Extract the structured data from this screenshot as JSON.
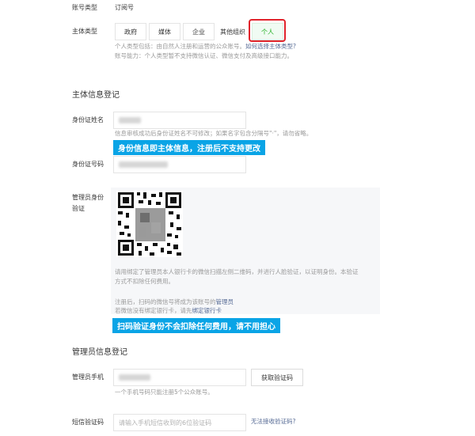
{
  "account_type": {
    "label": "账号类型",
    "value": "订阅号"
  },
  "entity_type": {
    "label": "主体类型",
    "options": [
      {
        "label": "政府"
      },
      {
        "label": "媒体"
      },
      {
        "label": "企业"
      },
      {
        "label": "其他组织"
      },
      {
        "label": "个人"
      }
    ],
    "selected": "个人",
    "hint_line1": "个人类型包括：由自然人注册和运营的公众账号。",
    "hint_link": "如何选择主体类型?",
    "hint_line2": "账号能力：个人类型暂不支持微信认证、微信支付及高级接口能力。"
  },
  "entity_info": {
    "title": "主体信息登记",
    "id_name": {
      "label": "身份证姓名",
      "hint": "信息审核成功后身份证姓名不可修改；如果名字包含分隔号\"·\"，请勿省略。"
    },
    "banner1": "身份信息即主体信息，注册后不支持更改",
    "id_number": {
      "label": "身份证号码"
    },
    "admin_verify": {
      "label_line1": "管理员身份",
      "label_line2": "验证",
      "desc_line1": "请用绑定了管理员本人银行卡的微信扫描左侧二维码，并进行人脸验证，以证明身份。本验证",
      "desc_line2": "方式不扣除任何费用。",
      "note1_prefix": "注册后，扫码的微信号将成为该账号的",
      "note1_link": "管理员",
      "note2_prefix": "若微信没有绑定银行卡，请先",
      "note2_link": "绑定银行卡"
    },
    "banner2": "扫码验证身份不会扣除任何费用，请不用担心"
  },
  "admin_info": {
    "title": "管理员信息登记",
    "phone": {
      "label": "管理员手机",
      "button": "获取验证码",
      "hint": "一个手机号码只能注册5个公众账号。"
    },
    "sms": {
      "label": "短信验证码",
      "placeholder": "请输入手机短信收到的6位验证码",
      "link": "无法接收验证码?"
    }
  },
  "colors": {
    "banner": "#0aa4e6",
    "selected_green": "#1aad19",
    "highlight_red": "#e0232b",
    "link_blue": "#576b95"
  }
}
